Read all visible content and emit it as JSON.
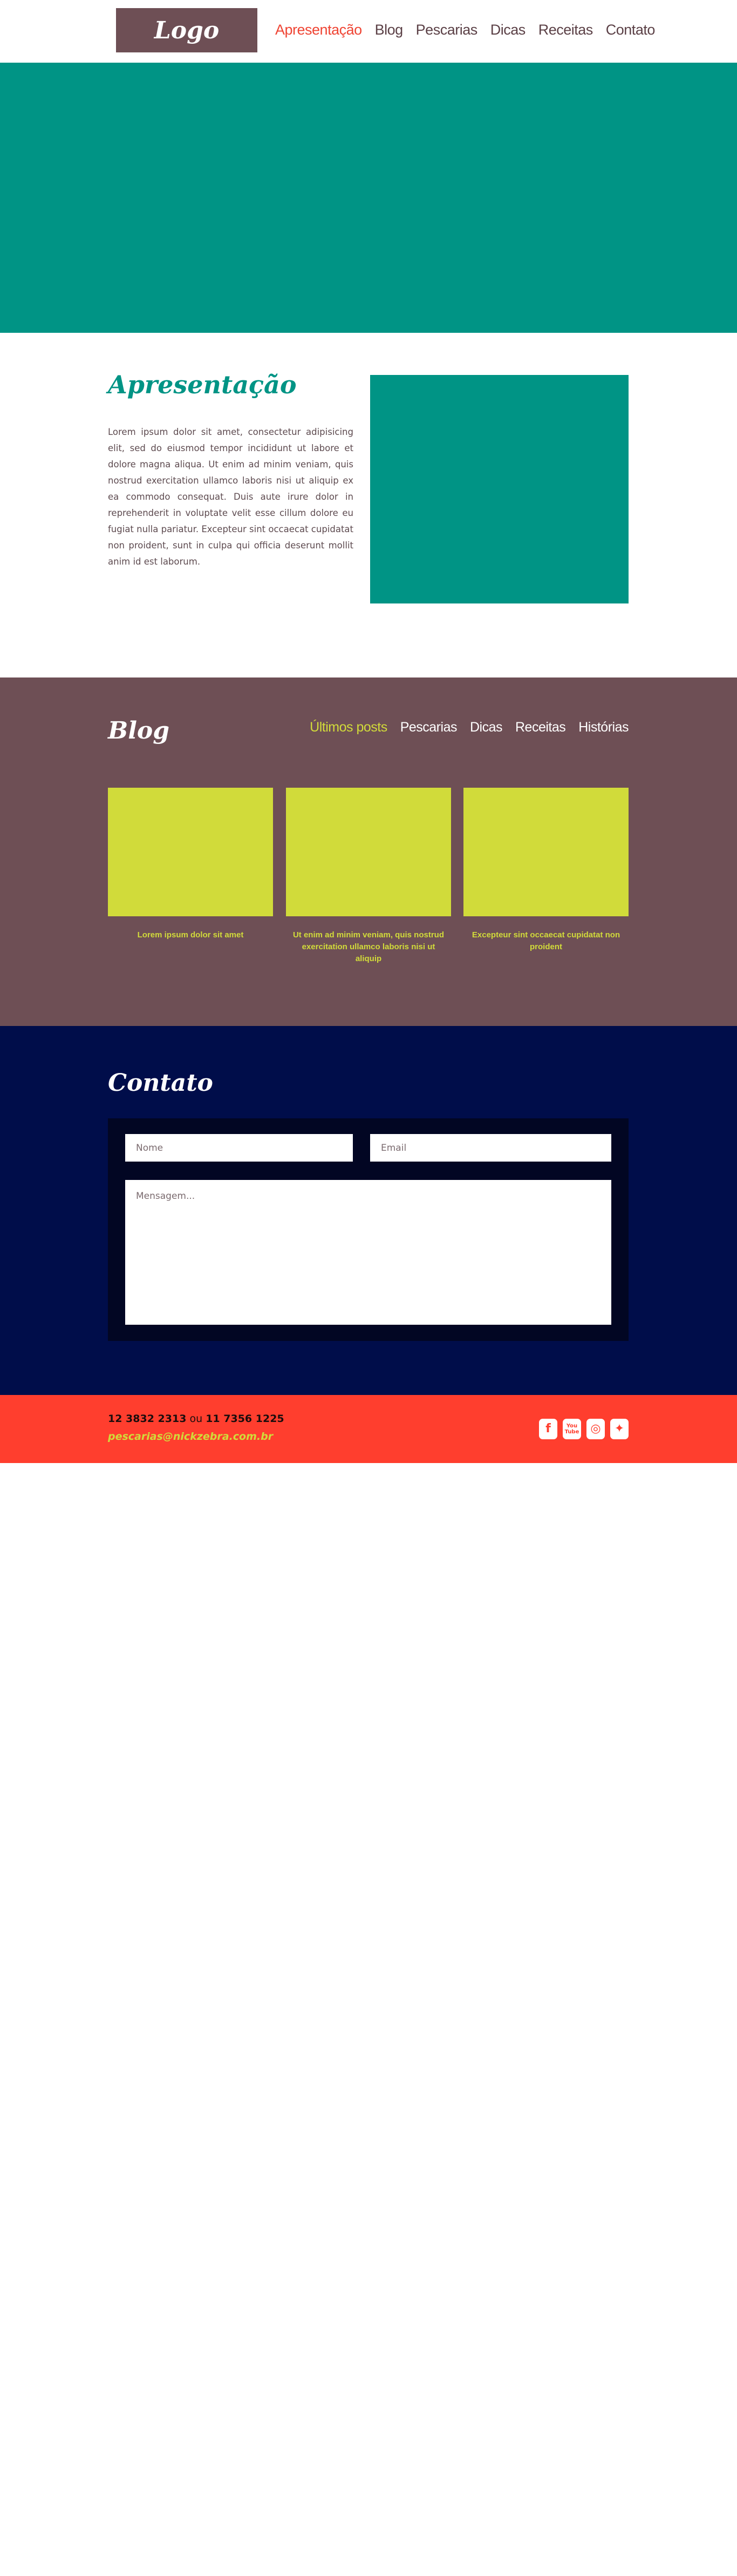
{
  "header": {
    "logo": "Logo",
    "nav": [
      "Apresentação",
      "Blog",
      "Pescarias",
      "Dicas",
      "Receitas",
      "Contato"
    ]
  },
  "apresentacao": {
    "title": "Apresentação",
    "text": "Lorem ipsum dolor sit amet, consectetur adipisicing elit, sed do eiusmod tempor incididunt ut labore et dolore magna aliqua. Ut enim ad minim veniam, quis nostrud exercitation ullamco laboris nisi ut aliquip ex ea commodo consequat. Duis aute irure dolor in reprehenderit in voluptate velit esse cillum dolore eu fugiat nulla pariatur. Excepteur sint occaecat cupidatat non proident, sunt in culpa qui officia deserunt mollit anim id est laborum."
  },
  "blog": {
    "title": "Blog",
    "tabs": [
      "Últimos posts",
      "Pescarias",
      "Dicas",
      "Receitas",
      "Histórias"
    ],
    "posts": [
      {
        "caption": "Lorem ipsum dolor sit amet"
      },
      {
        "caption": "Ut enim ad minim veniam, quis nostrud exercitation ullamco laboris nisi ut aliquip"
      },
      {
        "caption": "Excepteur sint occaecat cupidatat non proident"
      }
    ]
  },
  "contato": {
    "title": "Contato",
    "nome_placeholder": "Nome",
    "email_placeholder": "Email",
    "mensagem_placeholder": "Mensagem..."
  },
  "footer": {
    "phone1": "12 3832 2313",
    "separator": "ou",
    "phone2": "11 7356 1225",
    "email": "pescarias@nickzebra.com.br",
    "social": [
      "facebook-icon",
      "youtube-icon",
      "instagram-icon",
      "twitter-icon"
    ]
  },
  "colors": {
    "teal": "#009485",
    "mauve": "#6e4f55",
    "lime": "#d1db3a",
    "navy": "#000d4a",
    "red": "#ff3e2e",
    "nav_active": "#ef4433"
  }
}
